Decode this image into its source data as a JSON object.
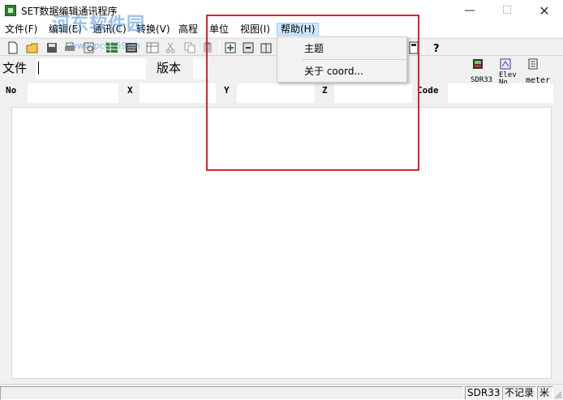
{
  "window": {
    "title": "SET数据编辑通讯程序",
    "controls": {
      "minimize": "—",
      "maximize": "☐",
      "close": "✕"
    }
  },
  "watermark": {
    "text": "河东软件园",
    "url": "www.pc0359.cn"
  },
  "menu": {
    "items": [
      {
        "label": "文件(F)"
      },
      {
        "label": "编辑(E)"
      },
      {
        "label": "通讯(C)"
      },
      {
        "label": "转换(V)"
      },
      {
        "label": "高程"
      },
      {
        "label": "单位"
      },
      {
        "label": "视图(I)"
      },
      {
        "label": "帮助(H)"
      }
    ],
    "active_index": 7
  },
  "help_menu": {
    "items": [
      {
        "label": "主题"
      },
      {
        "label": "关于 coord..."
      }
    ]
  },
  "file_row": {
    "file_label": "文件",
    "file_value": "",
    "version_label": "版本",
    "version_value": ""
  },
  "side_icons": [
    {
      "icon": "sdr33-icon",
      "caption": "SDR33"
    },
    {
      "icon": "elev-no-icon",
      "caption": "Elev\nNo"
    },
    {
      "icon": "meter-icon",
      "caption": "meter"
    }
  ],
  "coord_row": {
    "no_label": "No",
    "x_label": "X",
    "y_label": "Y",
    "z_label": "Z",
    "code_label": "Code"
  },
  "status_bar": {
    "device": "SDR33",
    "record": "不记录",
    "unit": "米"
  },
  "colors": {
    "highlight": "#e0212a",
    "menu_active": "#cce8ff",
    "watermark": "#4a90d9"
  }
}
